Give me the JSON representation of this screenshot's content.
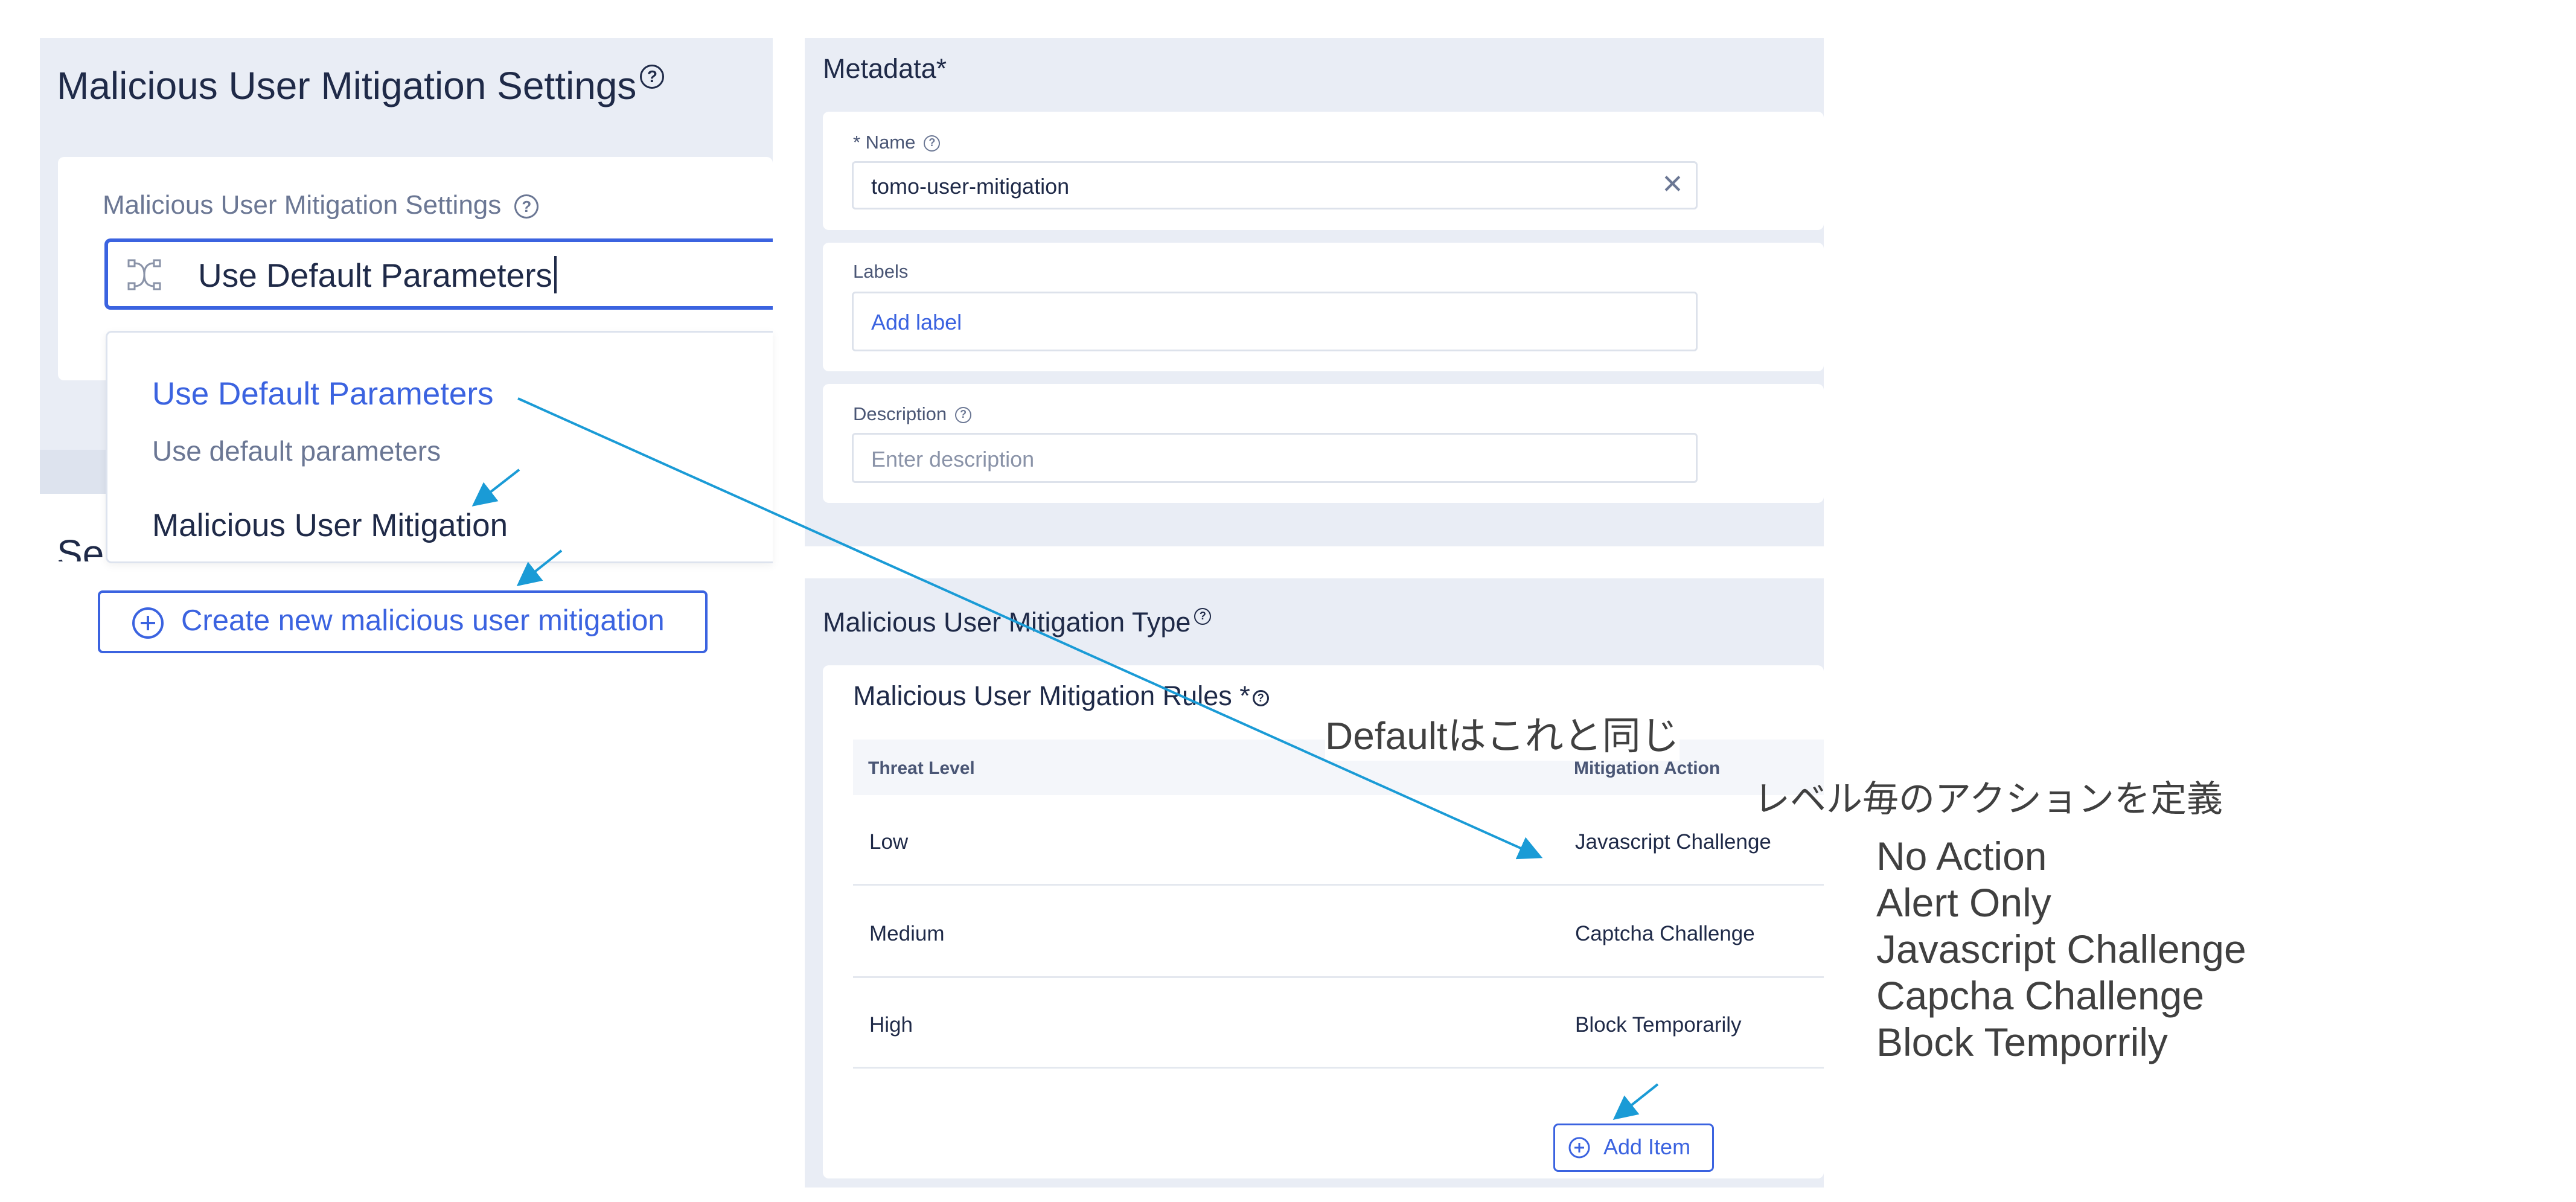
{
  "left": {
    "title": "Malicious User Mitigation Settings",
    "field_label": "Malicious User Mitigation Settings",
    "selected_value": "Use Default Parameters",
    "hidden_heading": "Se",
    "options": [
      {
        "title": "Use Default Parameters",
        "subtitle": "Use default parameters"
      },
      {
        "title": "Malicious User Mitigation"
      }
    ],
    "create_button": "Create new malicious user mitigation"
  },
  "metadata": {
    "title": "Metadata*",
    "name_label": "* Name",
    "name_value": "tomo-user-mitigation",
    "labels_label": "Labels",
    "labels_action": "Add label",
    "description_label": "Description",
    "description_placeholder": "Enter description"
  },
  "mitigation": {
    "title": "Malicious User Mitigation Type",
    "rules_title": "Malicious User Mitigation Rules *",
    "columns": [
      "Threat Level",
      "Mitigation Action"
    ],
    "rows": [
      {
        "level": "Low",
        "action": "Javascript Challenge"
      },
      {
        "level": "Medium",
        "action": "Captcha Challenge"
      },
      {
        "level": "High",
        "action": "Block Temporarily"
      }
    ],
    "add_item": "Add Item"
  },
  "annotations": {
    "default_note": "Defaultはこれと同じ",
    "level_note": "レベル毎のアクションを定義",
    "action_list": [
      "No Action",
      "Alert Only",
      "Javascript Challenge",
      "Capcha Challenge",
      "Block Temporrily"
    ]
  },
  "colors": {
    "accent": "#3b63e0",
    "panel_bg": "#e9edf5",
    "arrow": "#1a9bd6",
    "text": "#1f2a48"
  },
  "icons": [
    "help-icon",
    "workflow-icon",
    "plus-circle-icon",
    "close-icon"
  ]
}
